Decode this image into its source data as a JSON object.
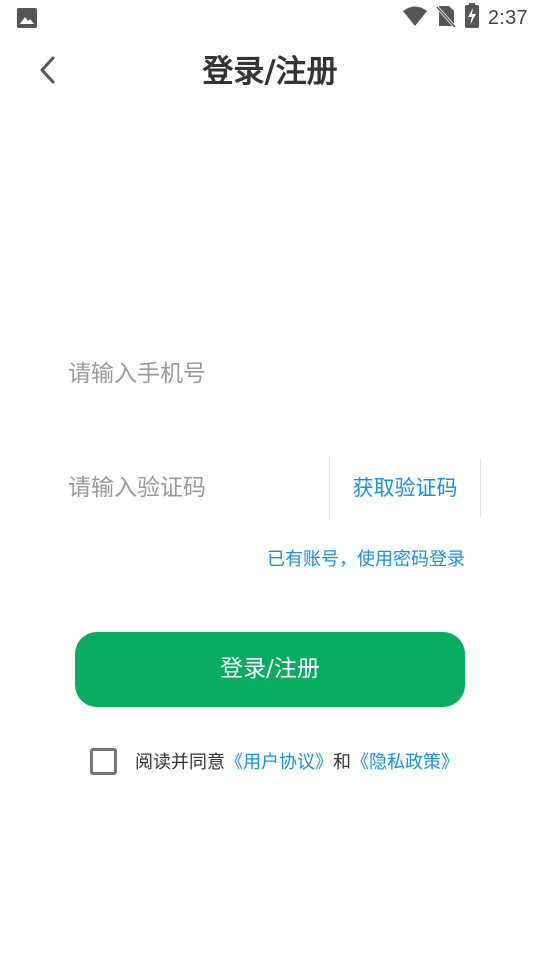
{
  "status_bar": {
    "time": "2:37",
    "icons": [
      "image-icon",
      "wifi-icon",
      "no-sim-icon",
      "battery-charging-icon"
    ]
  },
  "header": {
    "back_icon": "chevron-left-icon",
    "title": "登录/注册"
  },
  "form": {
    "phone_placeholder": "请输入手机号",
    "phone_value": "",
    "code_placeholder": "请输入验证码",
    "code_value": "",
    "get_code_label": "获取验证码",
    "password_login_link": "已有账号，使用密码登录",
    "submit_label": "登录/注册"
  },
  "agreement": {
    "checked": false,
    "prefix": "阅读并同意",
    "user_agreement": "《用户协议》",
    "and": "和",
    "privacy_policy": "《隐私政策》"
  },
  "colors": {
    "accent_green": "#07ac61",
    "link_blue": "#1a8fe0"
  }
}
